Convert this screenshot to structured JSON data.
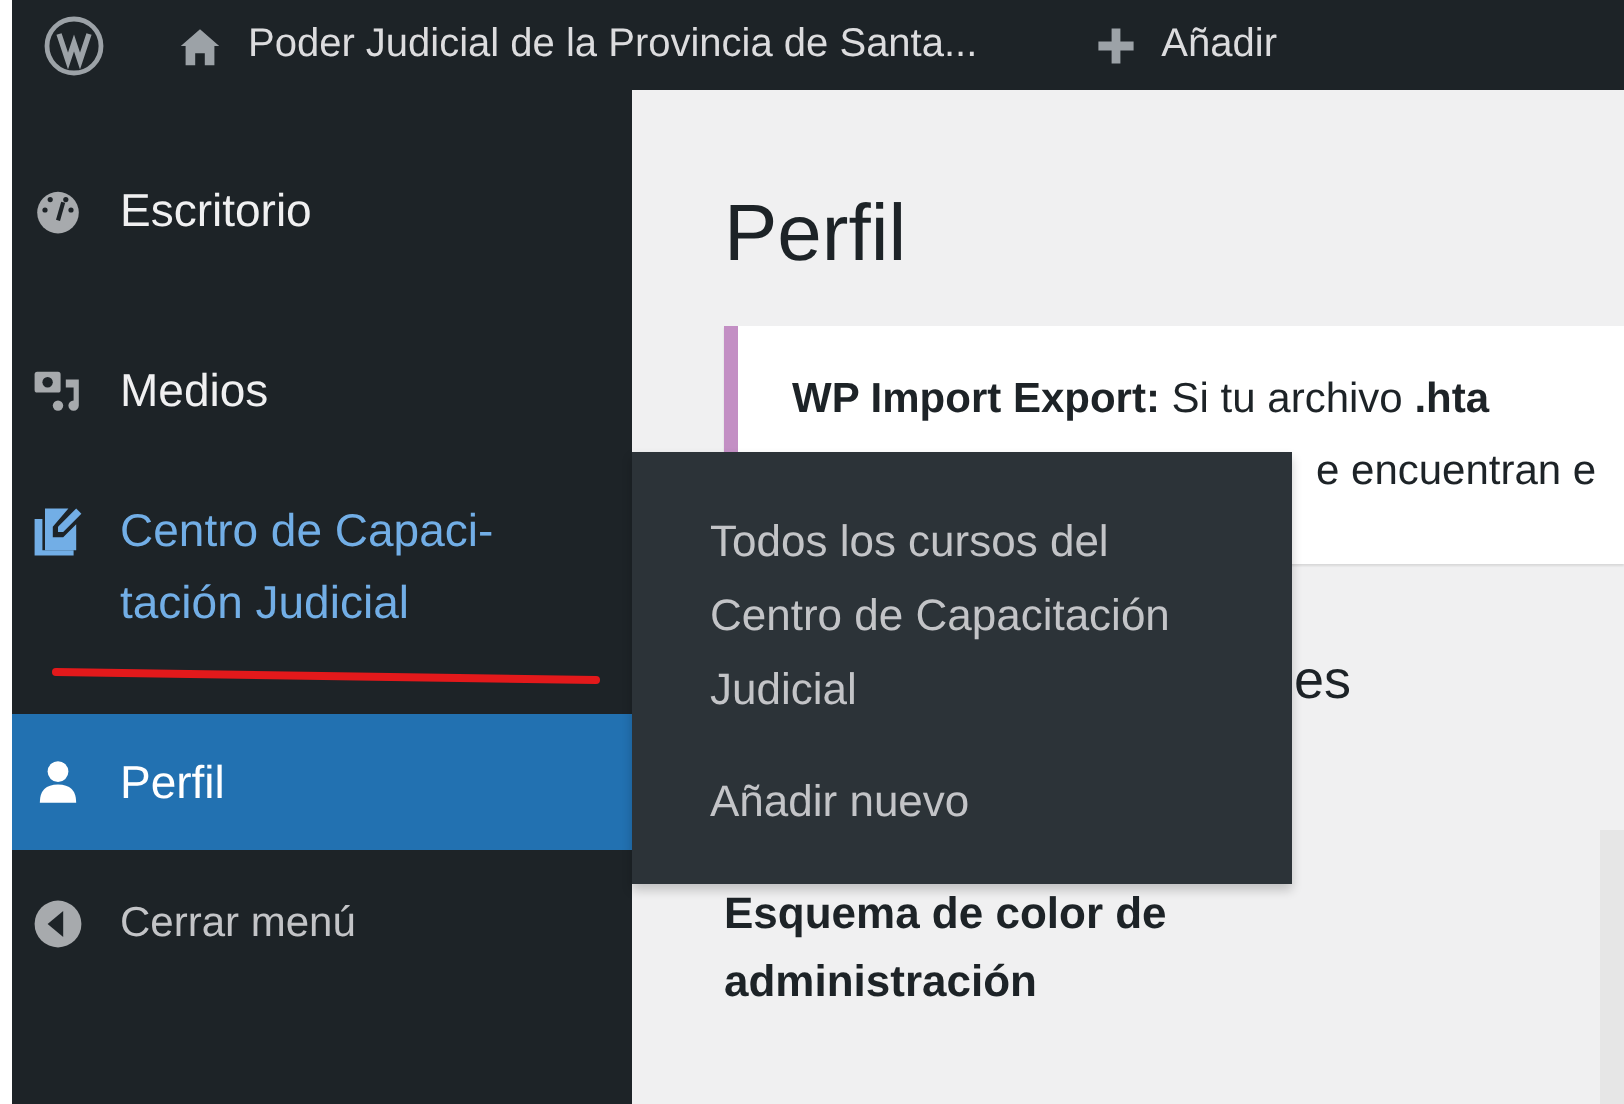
{
  "admin_bar": {
    "site_name": "Poder Judicial de la Provincia de Santa...",
    "new_label": "Añadir"
  },
  "sidebar": {
    "items": [
      {
        "label": "Escritorio",
        "selected": false,
        "open": false
      },
      {
        "label": "Medios",
        "selected": false,
        "open": false
      },
      {
        "label": "Centro de Capaci-tación Judicial",
        "selected": false,
        "open": true
      },
      {
        "label": "Perfil",
        "selected": true,
        "open": false
      }
    ],
    "collapse_label": "Cerrar menú"
  },
  "page": {
    "title": "Perfil",
    "notice": {
      "line_1": "**WP Import Export:** Si tu archivo **.hta**",
      "line_2": "e encuentran e"
    },
    "section_heading": "es",
    "field_label": "Esquema de color de administración"
  },
  "flyout_menu": {
    "items": [
      {
        "label": "Todos los cursos del Centro de Capacitación Judicial"
      },
      {
        "label": "Añadir nuevo"
      }
    ]
  }
}
